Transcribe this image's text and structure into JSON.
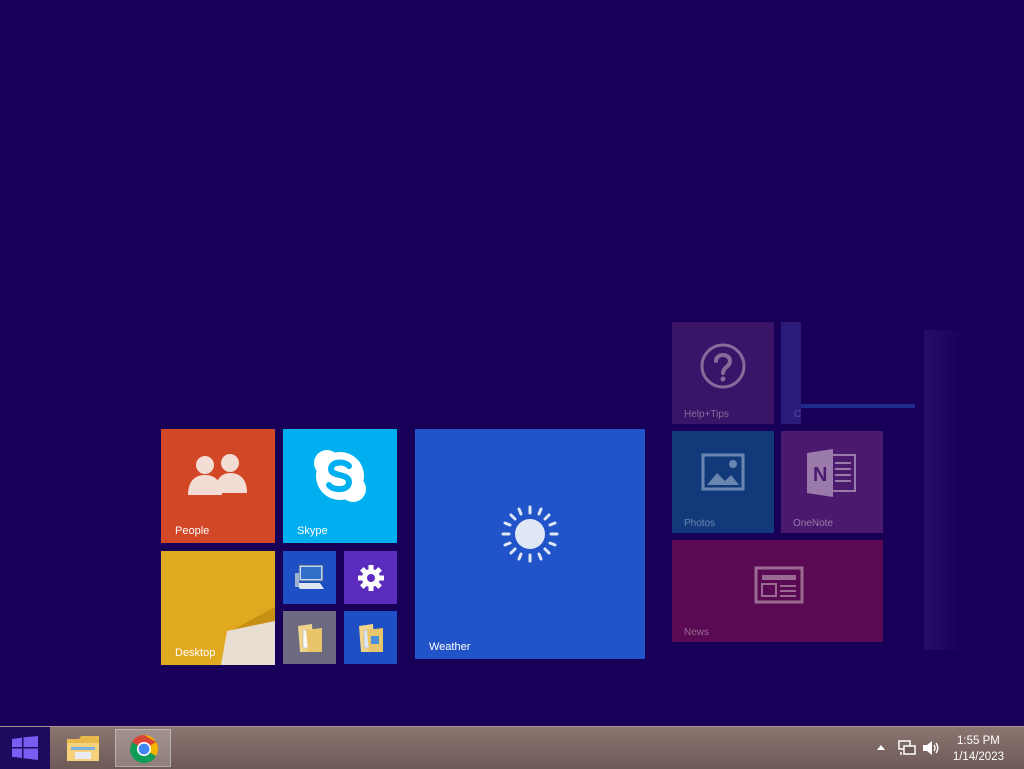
{
  "start_screen": {
    "tiles": {
      "people": {
        "label": "People",
        "color": "#d24726"
      },
      "skype": {
        "label": "Skype",
        "color": "#00aff0"
      },
      "desktop": {
        "label": "Desktop",
        "color": "#e1a91f"
      },
      "weather": {
        "label": "Weather",
        "color": "#2154c8"
      },
      "help_tips": {
        "label": "Help+Tips",
        "color": "#3a1468"
      },
      "photos": {
        "label": "Photos",
        "color": "#123a7a"
      },
      "onenote": {
        "label": "OneNote",
        "color": "#4b1a6e"
      },
      "news": {
        "label": "News",
        "color": "#5a0a52"
      },
      "partial": {
        "label": "C"
      }
    },
    "small_tiles": [
      {
        "name": "this-pc",
        "color": "#1f4fc4",
        "icon": "computer-icon"
      },
      {
        "name": "pc-settings",
        "color": "#5a2bbd",
        "icon": "gear-icon"
      },
      {
        "name": "documents",
        "color": "#6b6a80",
        "icon": "folder-icon"
      },
      {
        "name": "file-explorer",
        "color": "#1f4fc4",
        "icon": "folder-icon"
      }
    ]
  },
  "taskbar": {
    "start_icon": "windows-logo-icon",
    "pinned": [
      {
        "name": "file-explorer",
        "icon": "folder-icon"
      },
      {
        "name": "chrome",
        "icon": "chrome-icon",
        "active": true
      }
    ],
    "clock": {
      "time": "1:55 PM",
      "date": "1/14/2023"
    }
  }
}
